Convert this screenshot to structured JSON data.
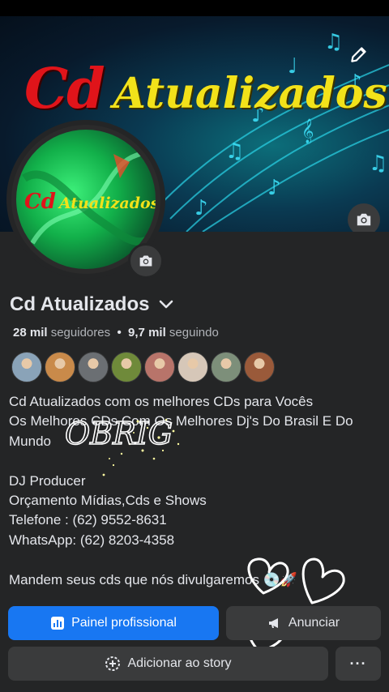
{
  "cover": {
    "title_cd": "Cd",
    "title_atualizados": "Atualizados"
  },
  "avatar": {
    "logo_cd": "Cd",
    "logo_atualizados": "Atualizados"
  },
  "profile": {
    "name": "Cd Atualizados",
    "followers_count": "28 mil",
    "followers_label": "seguidores",
    "separator": "•",
    "following_count": "9,7 mil",
    "following_label": "seguindo"
  },
  "friends": [
    {
      "color": "#8aa3b8"
    },
    {
      "color": "#c98a4a"
    },
    {
      "color": "#6b6f73"
    },
    {
      "color": "#6f8a3a"
    },
    {
      "color": "#b8746a"
    },
    {
      "color": "#d6c7b8"
    },
    {
      "color": "#7d8f7a"
    },
    {
      "color": "#9a5a3a"
    }
  ],
  "bio": {
    "text": "Cd Atualizados com os melhores CDs para Vocês\nOs Melhores CDs Com Os Melhores Dj's Do Brasil E Do Mundo\n\nDJ Producer\nOrçamento Mídias,Cds e Shows\n Telefone : (62) 9552-8631\nWhatsApp: (62) 8203-4358\n\nMandem seus cds que nós divulgaremos 💿🚀"
  },
  "actions": {
    "professional_panel": "Painel profissional",
    "advertise": "Anunciar",
    "add_to_story": "Adicionar ao story",
    "more": "···"
  },
  "overlay": {
    "handwritten_word": "OBRIG"
  },
  "colors": {
    "background": "#242526",
    "primary": "#1877f2",
    "secondary_button": "#3a3b3c",
    "text": "#e4e6eb",
    "muted": "#b0b3b8"
  }
}
